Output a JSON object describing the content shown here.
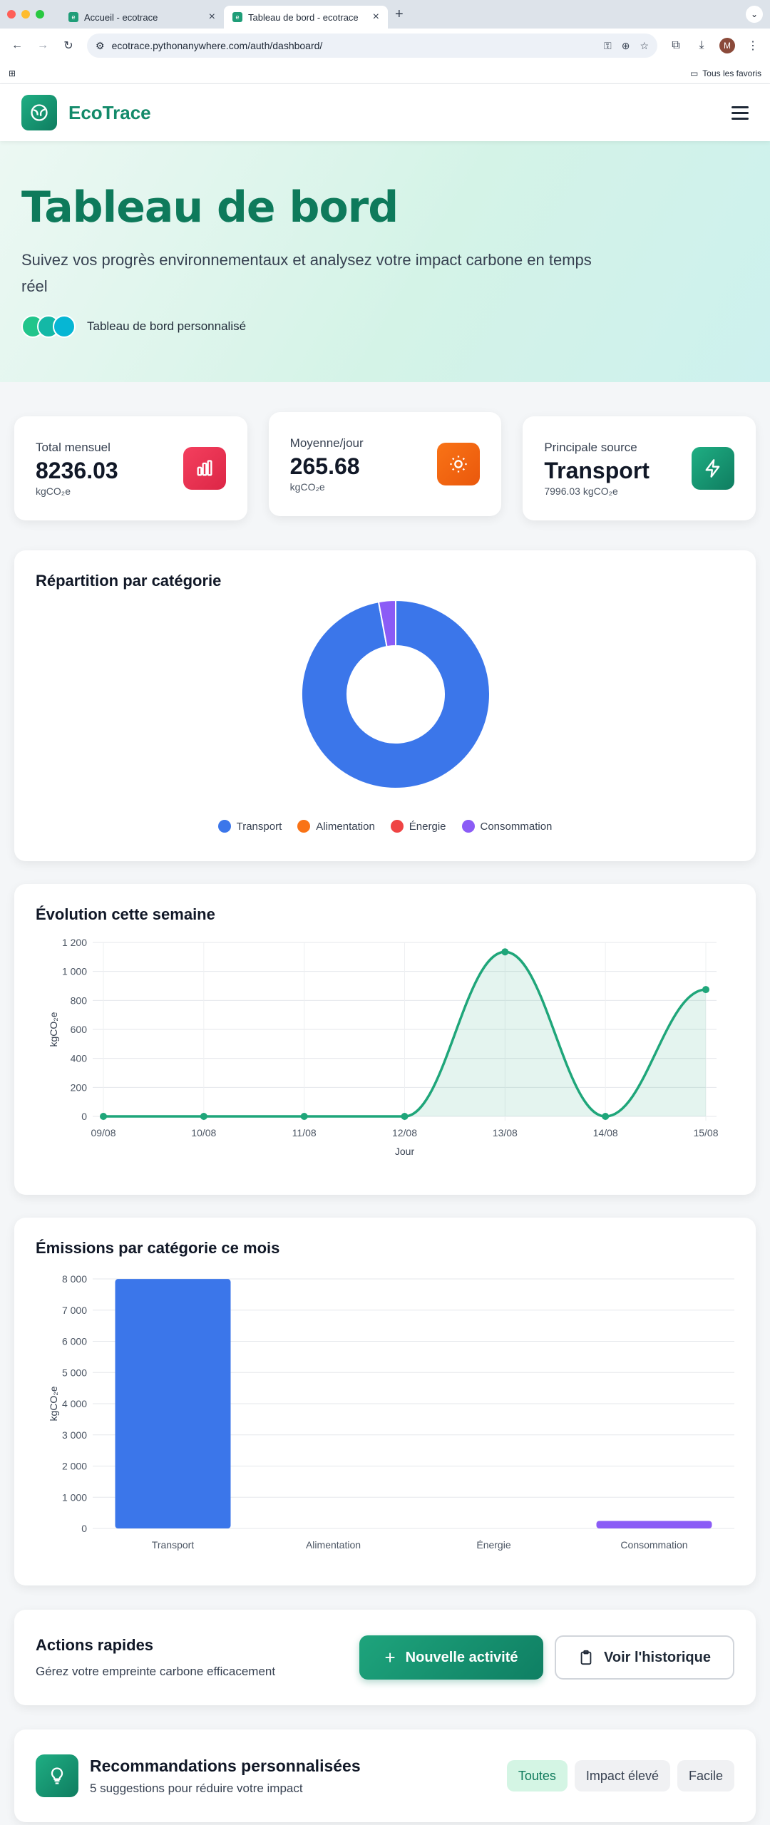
{
  "browser": {
    "tabs": [
      {
        "title": "Accueil - ecotrace",
        "active": false
      },
      {
        "title": "Tableau de bord - ecotrace",
        "active": true
      }
    ],
    "url": "ecotrace.pythonanywhere.com/auth/dashboard/",
    "bookmarks_all": "Tous les favoris",
    "profile_initial": "M"
  },
  "nav": {
    "brand": "EcoTrace"
  },
  "hero": {
    "title": "Tableau de bord",
    "subtitle": "Suivez vos progrès environnementaux et analysez votre impact carbone en temps réel",
    "badge": "Tableau de bord personnalisé"
  },
  "stats": [
    {
      "label": "Total mensuel",
      "value": "8236.03",
      "unit": "kgCO₂e",
      "icon": "bar-chart-icon",
      "color": "#e11d48"
    },
    {
      "label": "Moyenne/jour",
      "value": "265.68",
      "unit": "kgCO₂e",
      "icon": "sun-icon",
      "color": "#ea580c"
    },
    {
      "label": "Principale source",
      "value": "Transport",
      "unit": "7996.03 kgCO₂e",
      "icon": "bolt-icon",
      "color": "#10936f"
    }
  ],
  "colors": {
    "transport": "#3b76ea",
    "alimentation": "#f97316",
    "energie": "#ef4444",
    "consommation": "#8b5cf6",
    "accent": "#1fa67a"
  },
  "charts": {
    "donut_title": "Répartition par catégorie",
    "line_title": "Évolution cette semaine",
    "bar_title": "Émissions par catégorie ce mois"
  },
  "chart_data": [
    {
      "type": "pie",
      "title": "Répartition par catégorie",
      "categories": [
        "Transport",
        "Alimentation",
        "Énergie",
        "Consommation"
      ],
      "values": [
        7996.03,
        0,
        0,
        240.0
      ],
      "legend": "bottom"
    },
    {
      "type": "area",
      "title": "Évolution cette semaine",
      "x": [
        "09/08",
        "10/08",
        "11/08",
        "12/08",
        "13/08",
        "14/08",
        "15/08"
      ],
      "series": [
        {
          "values": [
            0,
            0,
            0,
            0,
            1135,
            0,
            875
          ]
        }
      ],
      "xlabel": "Jour",
      "ylabel": "kgCO₂e",
      "ylim": [
        0,
        1200
      ],
      "yticks": [
        "0",
        "200",
        "400",
        "600",
        "800",
        "1 000",
        "1 200"
      ],
      "grid": true
    },
    {
      "type": "bar",
      "title": "Émissions par catégorie ce mois",
      "categories": [
        "Transport",
        "Alimentation",
        "Énergie",
        "Consommation"
      ],
      "values": [
        7996.03,
        0,
        0,
        240.0
      ],
      "ylabel": "kgCO₂e",
      "ylim": [
        0,
        8000
      ],
      "yticks": [
        "0",
        "1 000",
        "2 000",
        "3 000",
        "4 000",
        "5 000",
        "6 000",
        "7 000",
        "8 000"
      ],
      "grid": true
    }
  ],
  "actions": {
    "title": "Actions rapides",
    "subtitle": "Gérez votre empreinte carbone efficacement",
    "new_activity": "Nouvelle activité",
    "history": "Voir l'historique"
  },
  "reco": {
    "title": "Recommandations personnalisées",
    "subtitle": "5 suggestions pour réduire votre impact",
    "filters": [
      "Toutes",
      "Impact élevé",
      "Facile"
    ]
  }
}
